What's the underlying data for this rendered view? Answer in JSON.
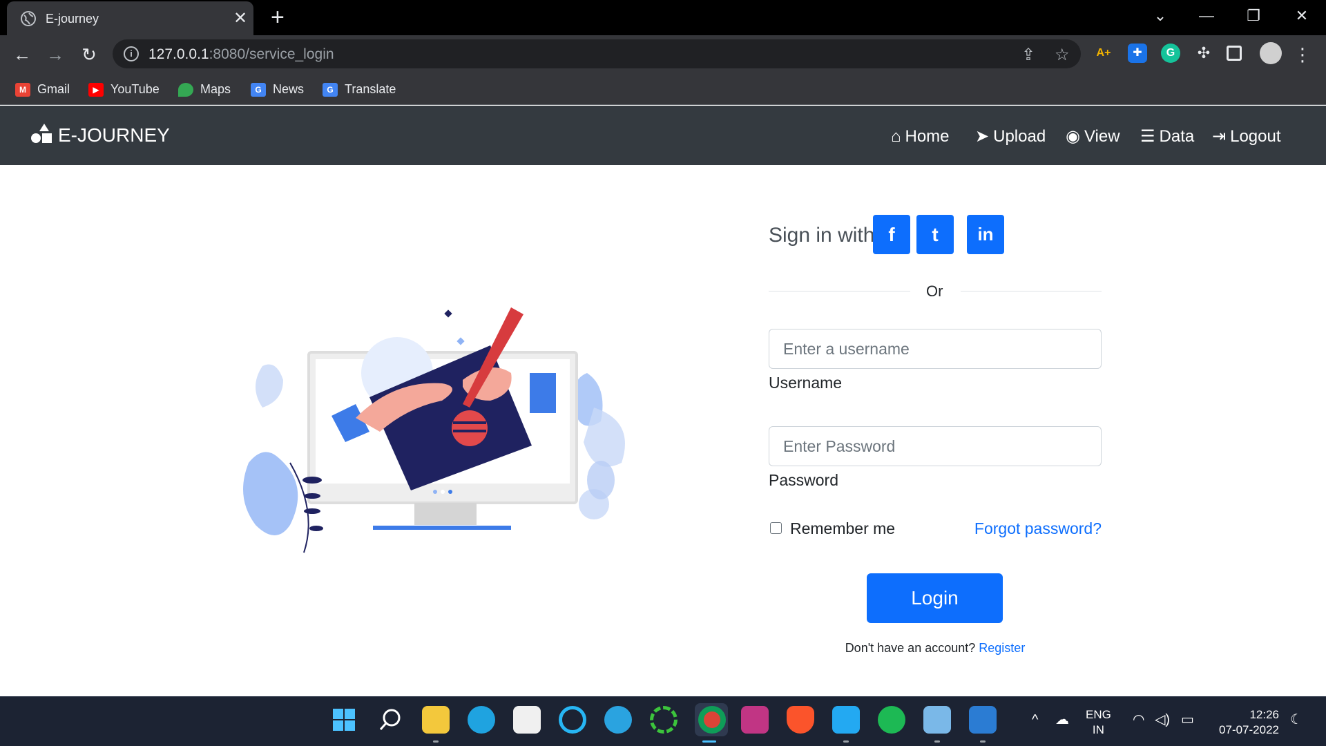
{
  "browser": {
    "tab_title": "E-journey",
    "url_host": "127.0.0.1",
    "url_rest": ":8080/service_login",
    "bookmarks": [
      "Gmail",
      "YouTube",
      "Maps",
      "News",
      "Translate"
    ],
    "extensions": [
      "A+",
      "G"
    ]
  },
  "site": {
    "brand": "E-JOURNEY",
    "nav": [
      "Home",
      "Upload",
      "View",
      "Data",
      "Logout"
    ]
  },
  "login": {
    "signin_label": "Sign in with",
    "social": [
      "f",
      "t",
      "in"
    ],
    "or": "Or",
    "username_placeholder": "Enter a username",
    "username_label": "Username",
    "password_placeholder": "Enter Password",
    "password_label": "Password",
    "remember": "Remember me",
    "forgot": "Forgot password?",
    "login_button": "Login",
    "no_account": "Don't have an account?",
    "register": "Register"
  },
  "taskbar": {
    "lang_line1": "ENG",
    "lang_line2": "IN",
    "time": "12:26",
    "date": "07-07-2022"
  },
  "colors": {
    "primary": "#0d6efd",
    "navbar": "#343a40",
    "chrome": "#35363a"
  }
}
